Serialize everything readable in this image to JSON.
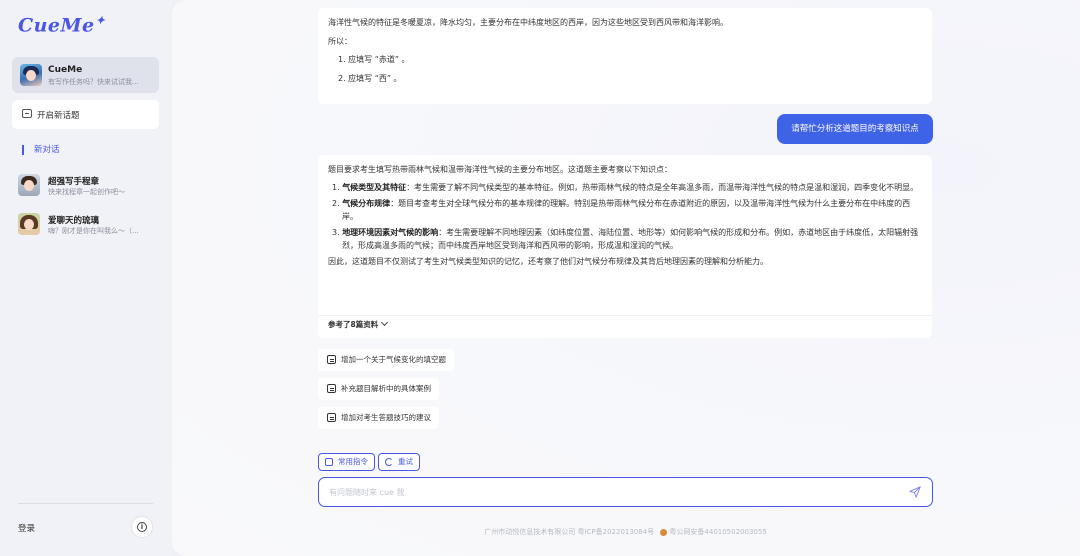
{
  "sidebar": {
    "logo": "CueMe",
    "agent": {
      "name": "CueMe",
      "subtitle": "有写作任务吗？快来试试我..."
    },
    "new_topic": "开启新话题",
    "active_chat": "新对话",
    "chats": [
      {
        "title": "超强写手程章",
        "subtitle": "快来找程章一起创作吧～"
      },
      {
        "title": "爱聊天的琉璃",
        "subtitle": "嗨？刚才是你在叫我么～（..."
      }
    ],
    "login": "登录"
  },
  "conversation": {
    "prev_answer": {
      "paragraph": "海洋性气候的特征是冬暖夏凉，降水均匀，主要分布在中纬度地区的西岸，因为这些地区受到西风带和海洋影响。",
      "so": "所以：",
      "items": [
        "1. 应填写 “赤道” 。",
        "2. 应填写 “西” 。"
      ]
    },
    "user_message": "请帮忙分析这道题目的考察知识点",
    "answer": {
      "intro": "题目要求考生填写热带雨林气候和温带海洋性气候的主要分布地区。这道题主要考察以下知识点：",
      "points": [
        {
          "num": "1.",
          "title": "气候类型及其特征",
          "text": "：考生需要了解不同气候类型的基本特征。例如，热带雨林气候的特点是全年高温多雨，而温带海洋性气候的特点是温和湿润，四季变化不明显。"
        },
        {
          "num": "2.",
          "title": "气候分布规律",
          "text": "：题目考查考生对全球气候分布的基本规律的理解。特别是热带雨林气候分布在赤道附近的原因，以及温带海洋性气候为什么主要分布在中纬度的西岸。"
        },
        {
          "num": "3.",
          "title": "地理环境因素对气候的影响",
          "text": "：考生需要理解不同地理因素（如纬度位置、海陆位置、地形等）如何影响气候的形成和分布。例如，赤道地区由于纬度低，太阳辐射强烈，形成高温多雨的气候；而中纬度西岸地区受到海洋和西风带的影响，形成温和湿润的气候。"
        }
      ],
      "conclusion": "因此，这道题目不仅测试了考生对气候类型知识的记忆，还考察了他们对气候分布规律及其背后地理因素的理解和分析能力。",
      "references": "参考了8篇资料"
    },
    "suggestions": [
      "增加一个关于气候变化的填空题",
      "补充题目解析中的具体案例",
      "增加对考生答题技巧的建议"
    ]
  },
  "composer": {
    "common_commands": "常用指令",
    "retry": "重试",
    "placeholder": "有问题随时来 cue 我"
  },
  "footer": {
    "company": "广州市动悦信息技术有限公司 粤ICP备2022013084号",
    "police": "粤公网安备44010502003055"
  },
  "colors": {
    "accent": "#4a56e8",
    "user_bubble": "#3f63e6"
  }
}
